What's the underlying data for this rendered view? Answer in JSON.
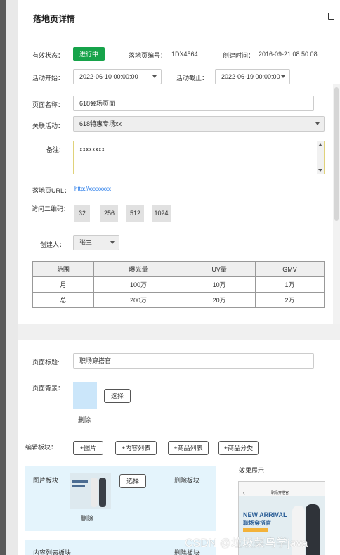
{
  "dialog": {
    "title": "落地页详情"
  },
  "info": {
    "status_label": "有效状态：",
    "status_value": "进行中",
    "page_no_label": "落地页编号：",
    "page_no_value": "1DX4564",
    "created_label": "创建时间：",
    "created_value": "2016-09-21  08:50:08",
    "start_label": "活动开始：",
    "start_value": "2022-06-10  00:00:00",
    "end_label": "活动截止：",
    "end_value": "2022-06-19  00:00:00",
    "name_label": "页面名称：",
    "name_value": "618会场页面",
    "activity_label": "关联活动：",
    "activity_value": "618特惠专场xx",
    "note_label": "备注:",
    "note_value": "xxxxxxxx",
    "url_label": "落地页URL：",
    "url_value": "http://xxxxxxxx",
    "qr_label": "访问二维码：",
    "qr_sizes": [
      "32",
      "256",
      "512",
      "1024"
    ],
    "creator_label": "创建人：",
    "creator_value": "张三"
  },
  "stats_table": {
    "headers": [
      "范围",
      "曝光量",
      "UV量",
      "GMV"
    ],
    "rows": [
      [
        "月",
        "100万",
        "10万",
        "1万"
      ],
      [
        "总",
        "200万",
        "20万",
        "2万"
      ]
    ]
  },
  "design": {
    "title_label": "页面标题:",
    "title_value": "职场穿搭官",
    "bg_label": "页面背景：",
    "bg_select": "选择",
    "bg_delete": "删除",
    "edit_label": "编辑板块：",
    "add_buttons": [
      "+图片",
      "+内容列表",
      "+商品列表",
      "+商品分类"
    ],
    "preview_label": "效果展示",
    "image_block": {
      "label": "图片板块",
      "select": "选择",
      "delete_block": "删除板块",
      "delete_img": "删除"
    },
    "content_block": {
      "label": "内容列表板块",
      "delete_block": "删除板块"
    },
    "phone": {
      "title": "职场穿搭官",
      "headline": "NEW ARRIVAL",
      "subhead": "职场穿搭官"
    }
  },
  "watermark": "CSDN @垃圾菜鸟学java"
}
